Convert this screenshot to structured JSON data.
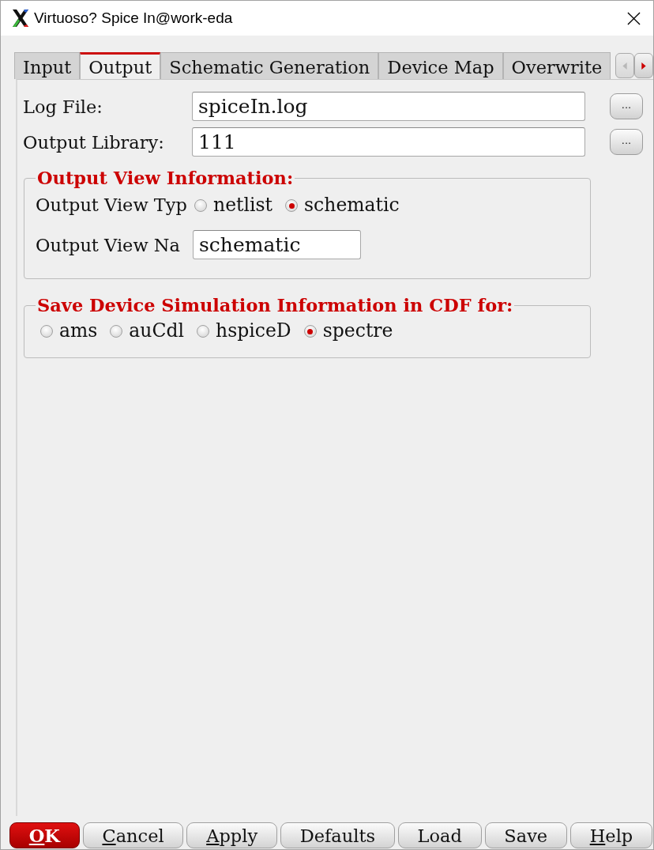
{
  "window": {
    "title": "Virtuoso? Spice In@work-eda"
  },
  "tabs": [
    {
      "label": "Input",
      "selected": false
    },
    {
      "label": "Output",
      "selected": true
    },
    {
      "label": "Schematic Generation",
      "selected": false
    },
    {
      "label": "Device Map",
      "selected": false
    },
    {
      "label": "Overwrite",
      "selected": false
    }
  ],
  "tab_scroll": [
    {
      "kind": "left",
      "disabled": true
    },
    {
      "kind": "right",
      "disabled": false
    }
  ],
  "fields": [
    {
      "label": "Log File:",
      "value": "spiceIn.log",
      "browse": "..."
    },
    {
      "label": "Output Library:",
      "value": "111",
      "browse": "..."
    }
  ],
  "groups": [
    {
      "title": "Output View Information:",
      "rows": [
        {
          "kind": "radio",
          "label": "Output View Typ",
          "options": [
            {
              "label": "netlist",
              "selected": false
            },
            {
              "label": "schematic",
              "selected": true
            }
          ]
        },
        {
          "kind": "field",
          "label": "Output View Na",
          "value": "schematic"
        }
      ]
    },
    {
      "title": "Save Device Simulation Information in CDF for:",
      "rows": [
        {
          "kind": "radio",
          "options": [
            {
              "label": "ams",
              "selected": false
            },
            {
              "label": "auCdl",
              "selected": false
            },
            {
              "label": "hspiceD",
              "selected": false
            },
            {
              "label": "spectre",
              "selected": true
            }
          ]
        }
      ]
    }
  ],
  "buttons": [
    {
      "label": "OK",
      "kind": "primary",
      "mnemonic": true
    },
    {
      "label": "Cancel",
      "kind": "normal",
      "mnemonic": true
    },
    {
      "label": "Apply",
      "kind": "normal",
      "mnemonic": true
    },
    {
      "label": "Defaults",
      "kind": "normal",
      "mnemonic": false
    },
    {
      "label": "Load",
      "kind": "normal",
      "mnemonic": false
    },
    {
      "label": "Save",
      "kind": "normal",
      "mnemonic": false
    },
    {
      "label": "Help",
      "kind": "normal",
      "mnemonic": true
    }
  ]
}
